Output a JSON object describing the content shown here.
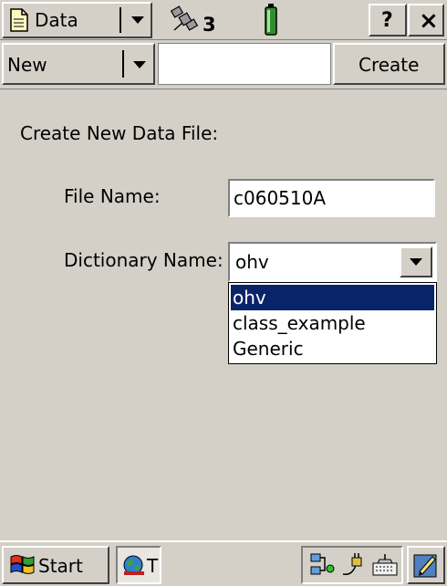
{
  "titlebar": {
    "app_menu_label": "Data",
    "satellite_count": "3",
    "help_label": "?",
    "close_label": "×"
  },
  "toolbar": {
    "mode_value": "New",
    "create_label": "Create"
  },
  "form": {
    "heading": "Create New Data File:",
    "file_name_label": "File Name:",
    "file_name_value": "c060510A",
    "dictionary_label": "Dictionary Name:",
    "dictionary_value": "ohv",
    "dictionary_options": [
      "ohv",
      "class_example",
      "Generic"
    ],
    "dictionary_selected_index": 0
  },
  "taskbar": {
    "start_label": "Start",
    "task_label": "T"
  },
  "colors": {
    "window_bg": "#d4d0c8",
    "selection": "#0a246a",
    "battery_green": "#2f8f2f"
  },
  "icons": [
    "document-icon",
    "satellite-icon",
    "battery-icon",
    "windows-flag-icon",
    "terrasync-icon",
    "network-icon",
    "power-icon",
    "keyboard-icon",
    "pen-icon"
  ]
}
